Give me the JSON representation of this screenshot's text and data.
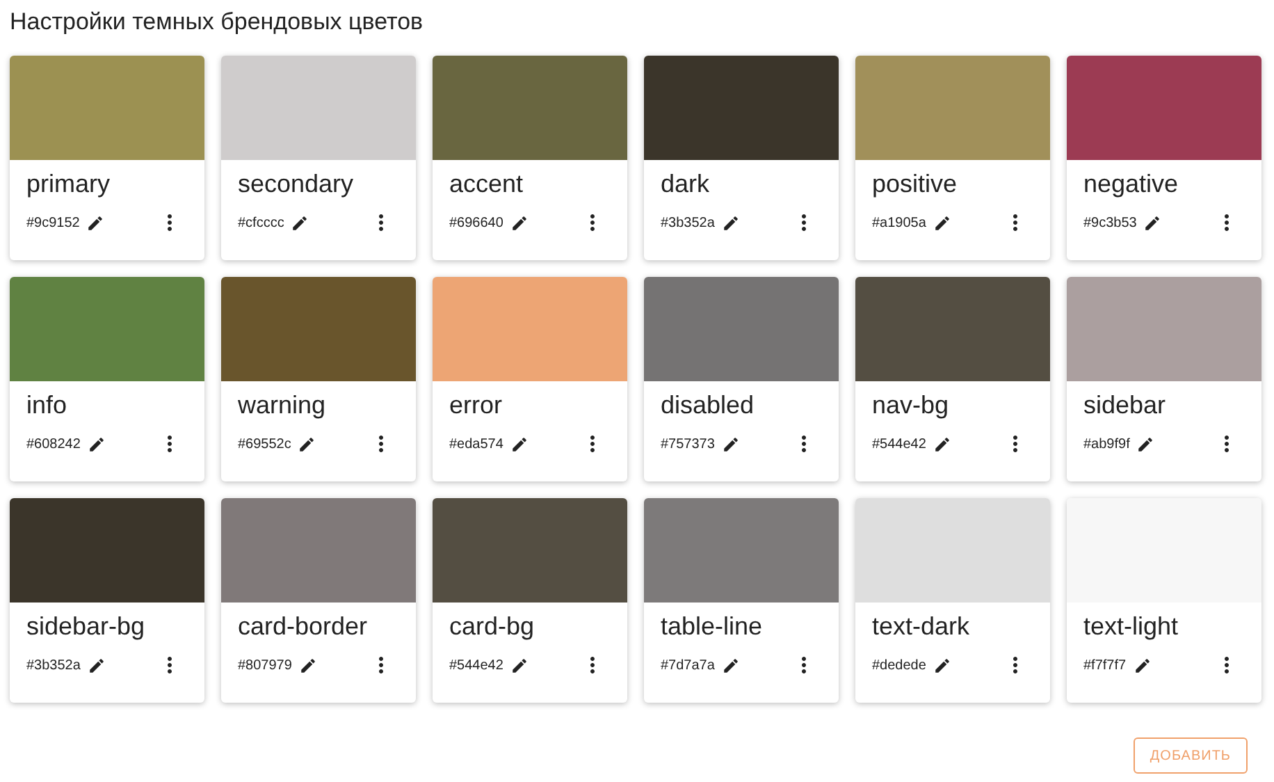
{
  "title": "Настройки темных брендовых цветов",
  "colors": [
    {
      "name": "primary",
      "hex": "#9c9152",
      "color": "#9c9152"
    },
    {
      "name": "secondary",
      "hex": "#cfcccc",
      "color": "#cfcccc"
    },
    {
      "name": "accent",
      "hex": "#696640",
      "color": "#696640"
    },
    {
      "name": "dark",
      "hex": "#3b352a",
      "color": "#3b352a"
    },
    {
      "name": "positive",
      "hex": "#a1905a",
      "color": "#a1905a"
    },
    {
      "name": "negative",
      "hex": "#9c3b53",
      "color": "#9c3b53"
    },
    {
      "name": "info",
      "hex": "#608242",
      "color": "#608242"
    },
    {
      "name": "warning",
      "hex": "#69552c",
      "color": "#69552c"
    },
    {
      "name": "error",
      "hex": "#eda574",
      "color": "#eda574"
    },
    {
      "name": "disabled",
      "hex": "#757373",
      "color": "#757373"
    },
    {
      "name": "nav-bg",
      "hex": "#544e42",
      "color": "#544e42"
    },
    {
      "name": "sidebar",
      "hex": "#ab9f9f",
      "color": "#ab9f9f"
    },
    {
      "name": "sidebar-bg",
      "hex": "#3b352a",
      "color": "#3b352a"
    },
    {
      "name": "card-border",
      "hex": "#807979",
      "color": "#807979"
    },
    {
      "name": "card-bg",
      "hex": "#544e42",
      "color": "#544e42"
    },
    {
      "name": "table-line",
      "hex": "#7d7a7a",
      "color": "#7d7a7a"
    },
    {
      "name": "text-dark",
      "hex": "#dedede",
      "color": "#dedede"
    },
    {
      "name": "text-light",
      "hex": "#f7f7f7",
      "color": "#f7f7f7"
    }
  ],
  "add_button": "ДОБАВИТЬ"
}
